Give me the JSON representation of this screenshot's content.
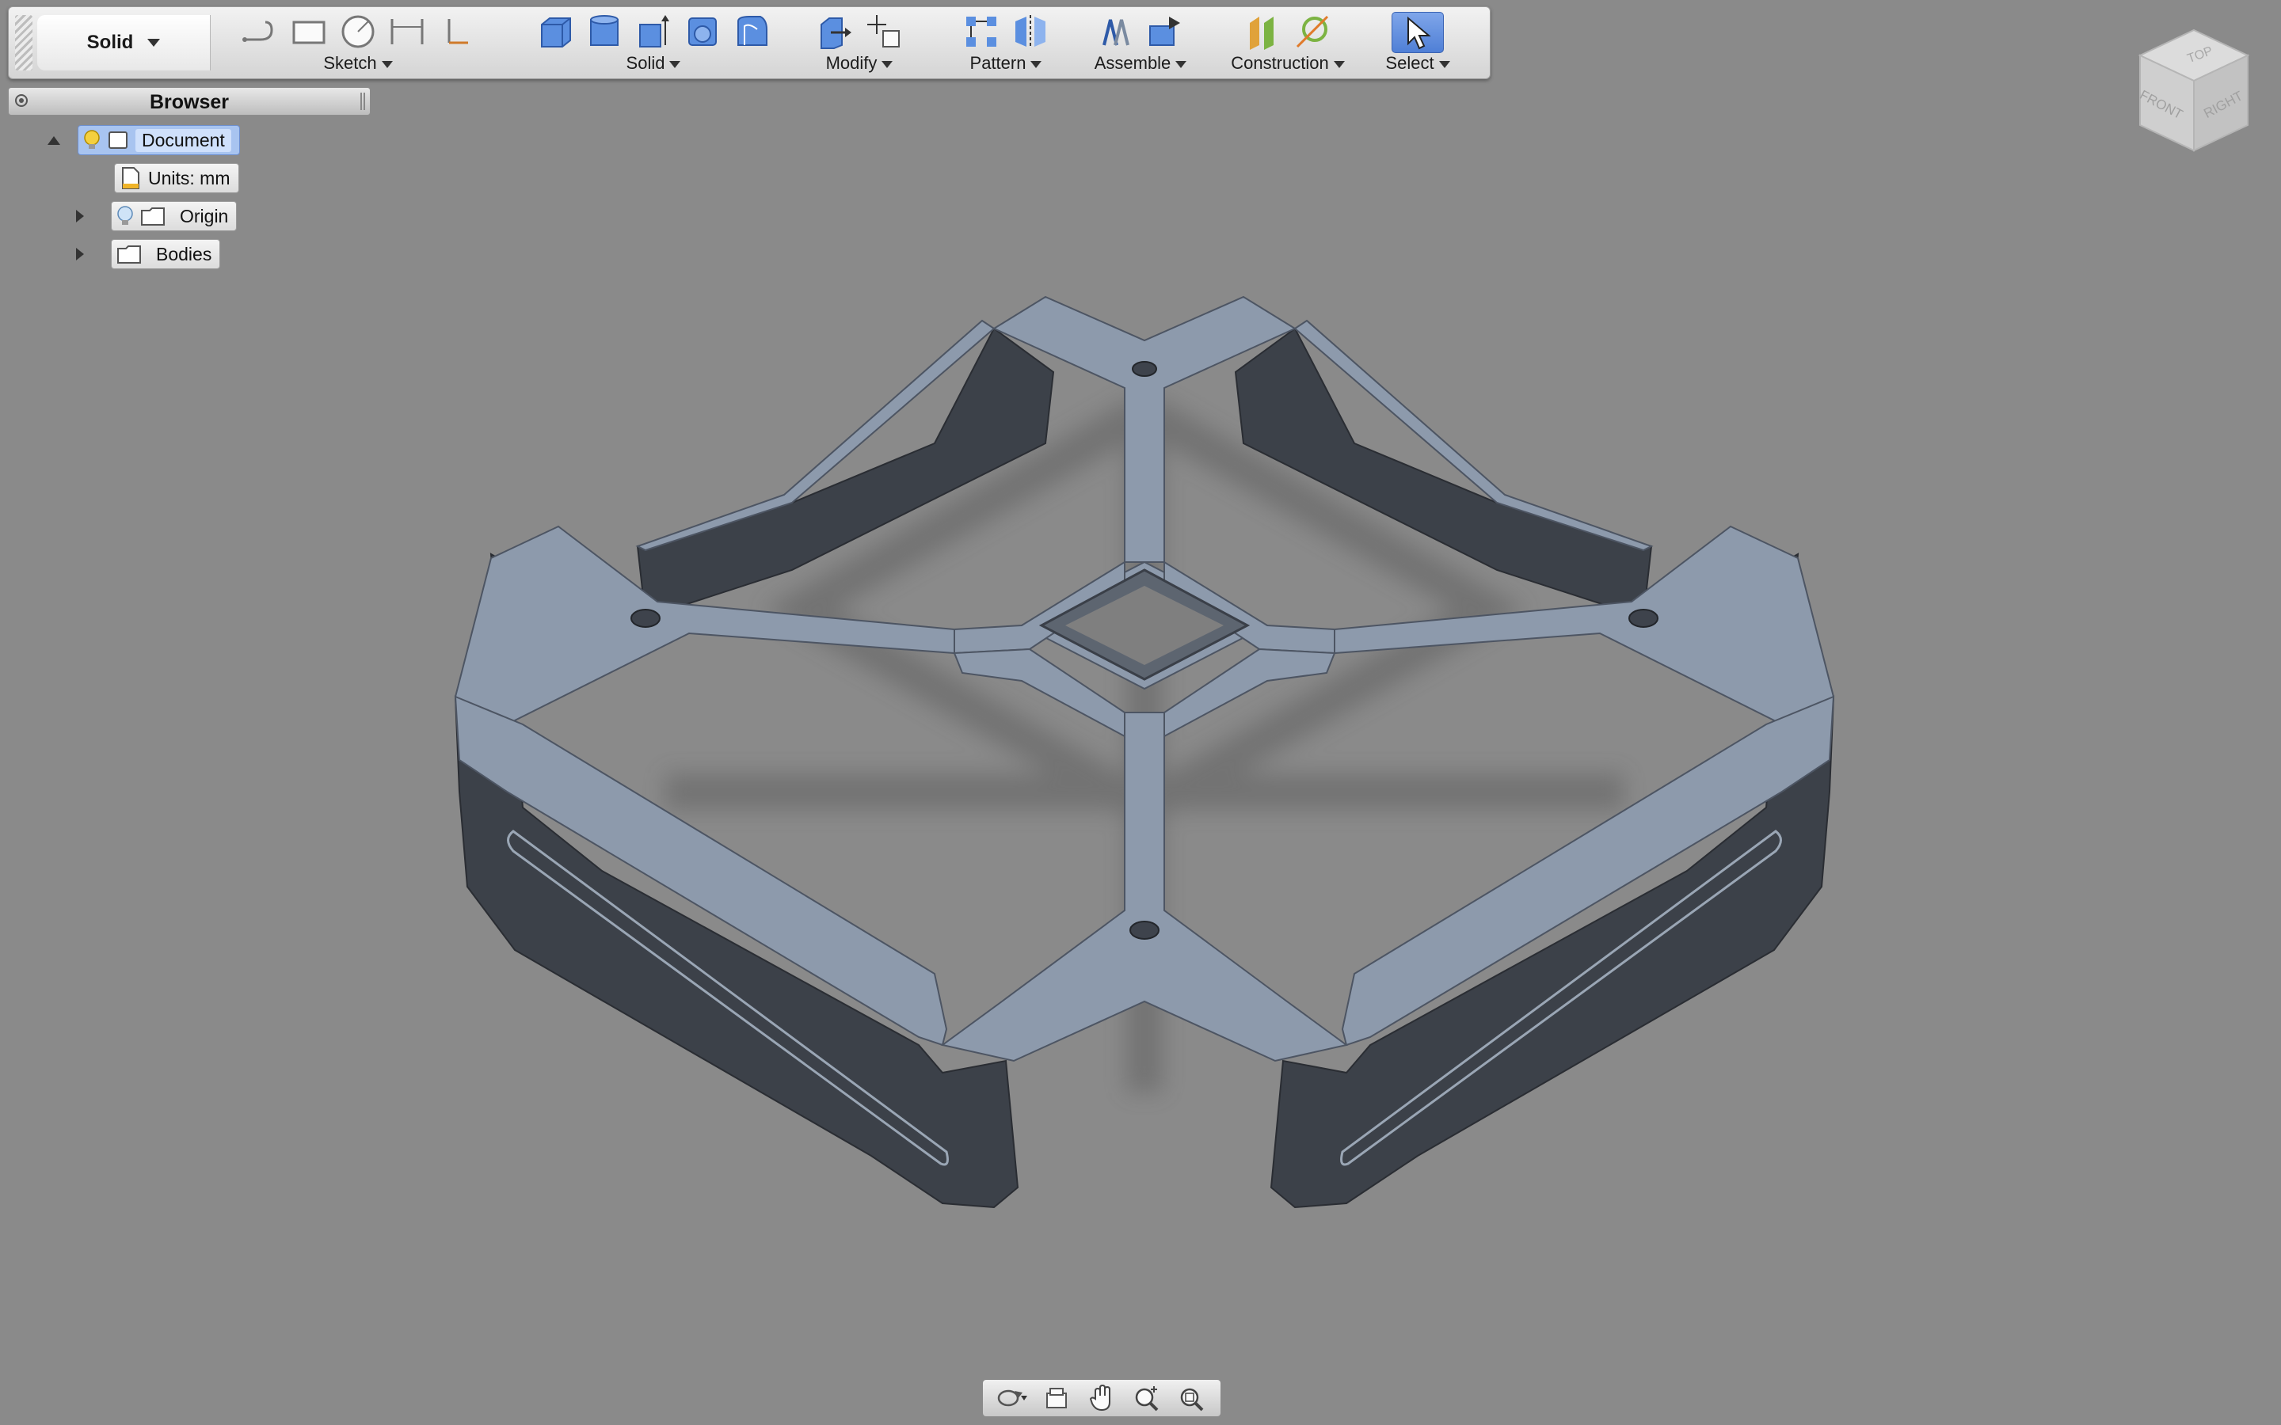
{
  "toolbar": {
    "workspace": "Solid",
    "groups": {
      "sketch": "Sketch",
      "solid": "Solid",
      "modify": "Modify",
      "pattern": "Pattern",
      "assemble": "Assemble",
      "construction": "Construction",
      "select": "Select"
    }
  },
  "viewcube": {
    "top": "TOP",
    "front": "FRONT",
    "right": "RIGHT"
  },
  "browser": {
    "title": "Browser",
    "items": [
      {
        "label": "Document"
      },
      {
        "label": "Units: mm"
      },
      {
        "label": "Origin"
      },
      {
        "label": "Bodies"
      }
    ]
  },
  "colors": {
    "viewport_bg": "#8a8a8a",
    "model_top": "#8d9aac",
    "model_side": "#3c4149",
    "select_accent": "#4f7fd6"
  },
  "icons": {
    "navbar": [
      "orbit-icon",
      "look-at-icon",
      "pan-icon",
      "zoom-icon",
      "fit-icon"
    ]
  }
}
